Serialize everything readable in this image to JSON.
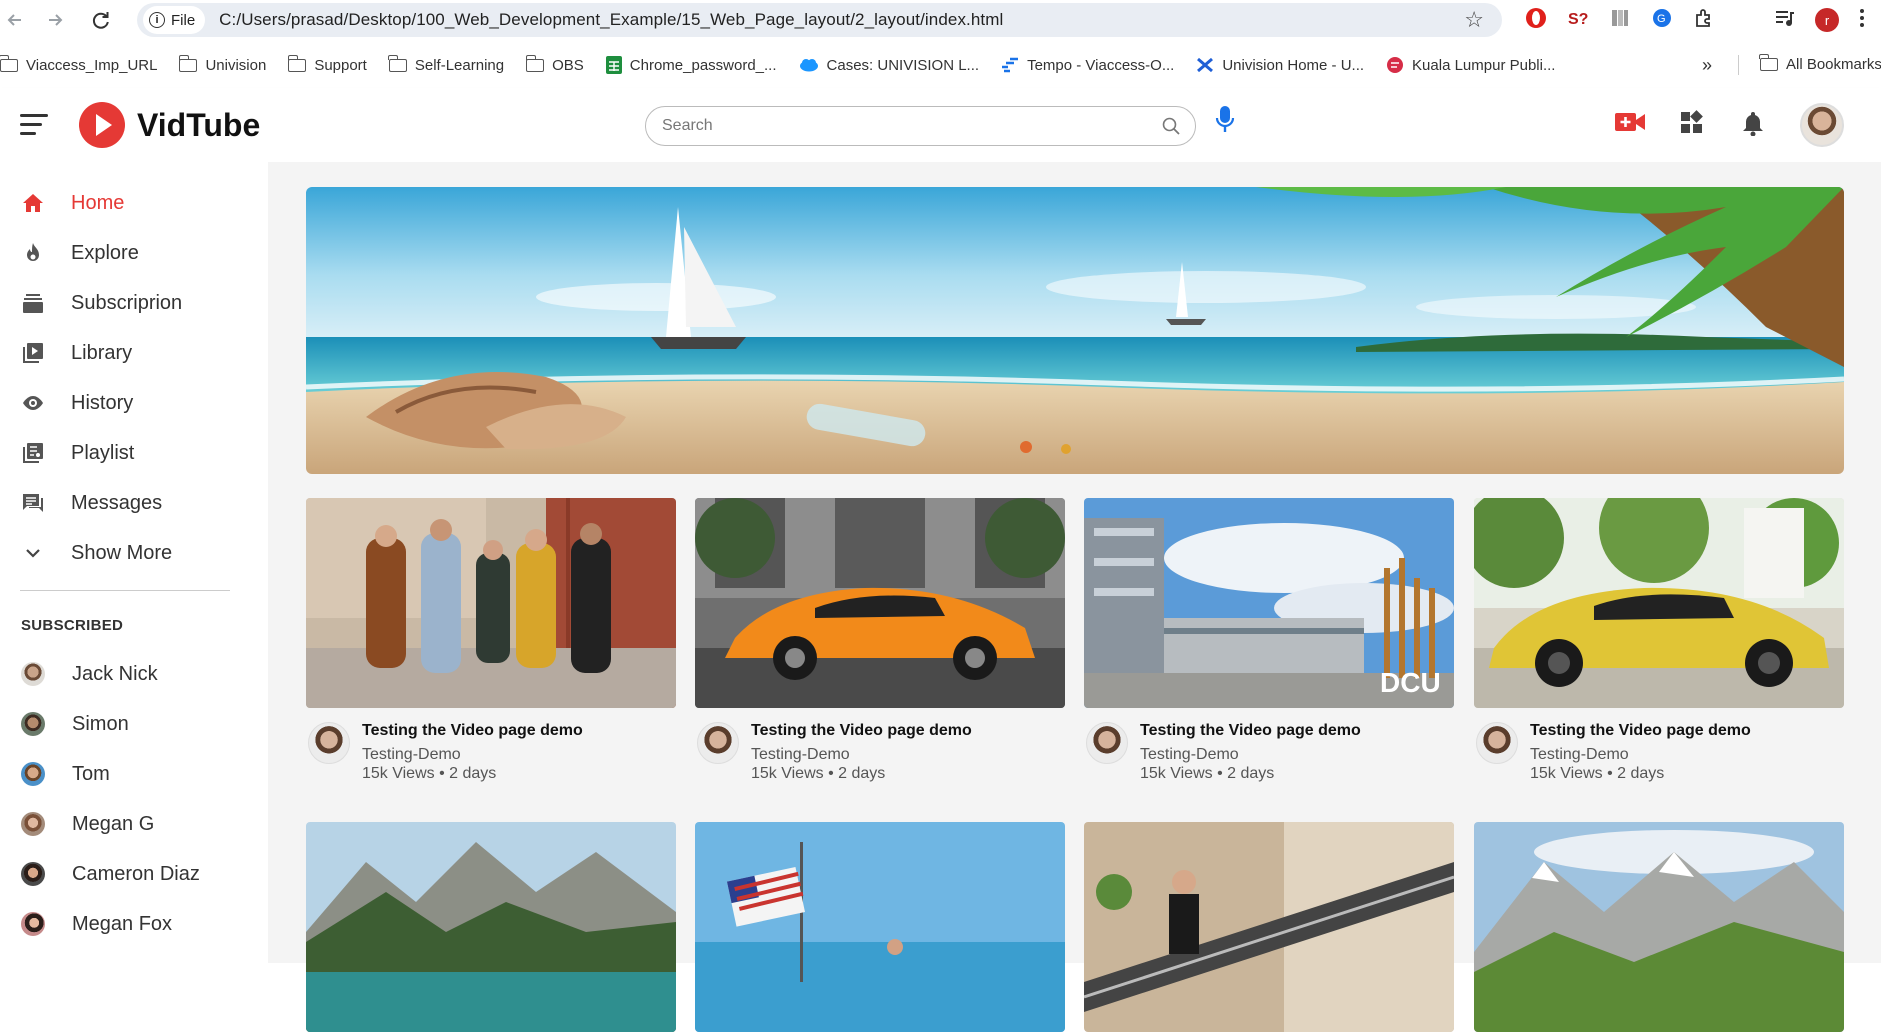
{
  "browser": {
    "file_chip": "File",
    "url": "C:/Users/prasad/Desktop/100_Web_Development_Example/15_Web_Page_layout/2_layout/index.html",
    "profile_initial": "r",
    "bookmarks": [
      {
        "label": "Viaccess_Imp_URL",
        "icon": "folder-icon"
      },
      {
        "label": "Univision",
        "icon": "folder-icon"
      },
      {
        "label": "Support",
        "icon": "folder-icon"
      },
      {
        "label": "Self-Learning",
        "icon": "folder-icon"
      },
      {
        "label": "OBS",
        "icon": "folder-icon"
      },
      {
        "label": "Chrome_password_...",
        "icon": "sheets-icon"
      },
      {
        "label": "Cases: UNIVISION L...",
        "icon": "salesforce-icon"
      },
      {
        "label": "Tempo - Viaccess-O...",
        "icon": "tempo-icon"
      },
      {
        "label": "Univision Home - U...",
        "icon": "confluence-icon"
      },
      {
        "label": "Kuala Lumpur Publi...",
        "icon": "library-icon"
      }
    ],
    "all_bookmarks": "All Bookmarks"
  },
  "header": {
    "logo_text": "VidTube",
    "search_placeholder": "Search",
    "accent": "#e53935"
  },
  "sidebar": {
    "items": [
      {
        "label": "Home",
        "icon": "home-icon",
        "active": true
      },
      {
        "label": "Explore",
        "icon": "explore-icon"
      },
      {
        "label": "Subscriprion",
        "icon": "subscription-icon"
      },
      {
        "label": "Library",
        "icon": "library-icon"
      },
      {
        "label": "History",
        "icon": "history-icon"
      },
      {
        "label": "Playlist",
        "icon": "playlist-icon"
      },
      {
        "label": "Messages",
        "icon": "messages-icon"
      },
      {
        "label": "Show More",
        "icon": "chevron-down-icon"
      }
    ],
    "subscribed_title": "SUBSCRIBED",
    "subscribed": [
      {
        "name": "Jack Nick"
      },
      {
        "name": "Simon"
      },
      {
        "name": "Tom"
      },
      {
        "name": "Megan G"
      },
      {
        "name": "Cameron Diaz"
      },
      {
        "name": "Megan Fox"
      }
    ]
  },
  "videos": [
    {
      "title": "Testing the Video page demo",
      "channel": "Testing-Demo",
      "stats": "15k Views • 2 days"
    },
    {
      "title": "Testing the Video page demo",
      "channel": "Testing-Demo",
      "stats": "15k Views • 2 days"
    },
    {
      "title": "Testing the Video page demo",
      "channel": "Testing-Demo",
      "stats": "15k Views • 2 days"
    },
    {
      "title": "Testing the Video page demo",
      "channel": "Testing-Demo",
      "stats": "15k Views • 2 days"
    }
  ],
  "thumb_text": {
    "dcu": "DCU"
  }
}
